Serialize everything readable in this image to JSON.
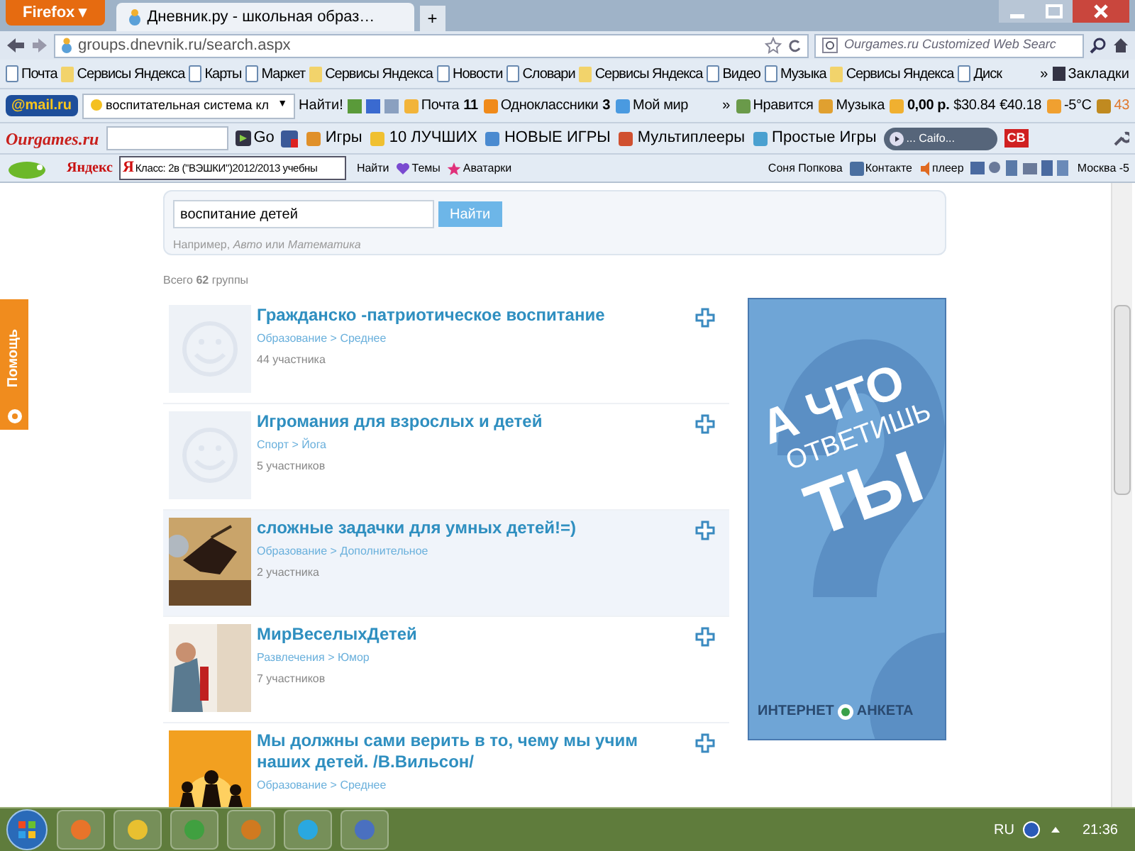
{
  "window": {
    "app_button": "Firefox",
    "menu_arrow": "▾",
    "new_tab": "+",
    "tab_title": "Дневник.ру - школьная образ…",
    "url": "groups.dnevnik.ru/search.aspx",
    "search_placeholder": "Ourgames.ru Customized Web Searc"
  },
  "bookmarks": [
    {
      "label": "Почта",
      "kind": "page"
    },
    {
      "label": "Сервисы Яндекса",
      "kind": "folder"
    },
    {
      "label": "Карты",
      "kind": "page"
    },
    {
      "label": "Маркет",
      "kind": "page"
    },
    {
      "label": "Сервисы Яндекса",
      "kind": "folder"
    },
    {
      "label": "Новости",
      "kind": "page"
    },
    {
      "label": "Словари",
      "kind": "page"
    },
    {
      "label": "Сервисы Яндекса",
      "kind": "folder"
    },
    {
      "label": "Видео",
      "kind": "page"
    },
    {
      "label": "Музыка",
      "kind": "page"
    },
    {
      "label": "Сервисы Яндекса",
      "kind": "folder"
    },
    {
      "label": "Диск",
      "kind": "page"
    }
  ],
  "bookmarks_more": "»",
  "bookmarks_menu": "Закладки",
  "mail_toolbar": {
    "logo": "@mail.ru",
    "search_value": "воспитательная система кл",
    "dropdown": "▼",
    "search_button": "Найти!",
    "links": [
      {
        "label": "Почта",
        "count": "11"
      },
      {
        "label": "Одноклассники",
        "count": "3"
      },
      {
        "label": "Мой мир"
      }
    ],
    "more": "»",
    "widgets": [
      "Нравится",
      "Музыка",
      "0,00 р.",
      "$30.84",
      "€40.18",
      "-5°C",
      "43"
    ]
  },
  "games_toolbar": {
    "logo": "Ourgames.ru",
    "go": "Go",
    "links": [
      "Игры",
      "10 ЛУЧШИХ",
      "НОВЫЕ ИГРЫ",
      "Мультиплееры",
      "Простые Игры"
    ],
    "player": "... Caifo...",
    "badge": "CB"
  },
  "yandex_toolbar": {
    "logo": "Яндекс",
    "field_badge": "Я",
    "field_value": "Класс: 2в (\"ВЭШКИ\")2012/2013 учебны",
    "find": "Найти",
    "links": [
      "Темы",
      "Аватарки"
    ],
    "user": "Соня Попкова",
    "vk": "Контакте",
    "player": "плеер",
    "weather": "Москва -5"
  },
  "help_tab": "Помощь",
  "search": {
    "value": "воспитание детей",
    "button": "Найти",
    "hint": "Например, *Авто* или *Математика*"
  },
  "total": "Всего **62** группы",
  "groups": [
    {
      "title": "Гражданско -патриотическое воспитание",
      "category": "Образование > Среднее",
      "members": "44 участника",
      "kind": "placeholder",
      "selected": false
    },
    {
      "title": "Игромания для взрослых и детей",
      "category": "Спорт > Йога",
      "members": "5 участников",
      "kind": "placeholder",
      "selected": false
    },
    {
      "title": "сложные задачки для умных детей!=)",
      "category": "Образование > Дополнительное",
      "members": "2 участника",
      "kind": "picture",
      "selected": true
    },
    {
      "title": "МирВеселыхДетей",
      "category": "Развлечения > Юмор",
      "members": "7 участников",
      "kind": "picture",
      "selected": false
    },
    {
      "title": "Мы должны сами верить в то, чему мы учим наших детей. /В.Вильсон/",
      "category": "Образование > Среднее",
      "kind": "picture",
      "selected": false
    }
  ],
  "ad": {
    "lines": [
      "А ЧТО",
      "ОТВЕТИШЬ",
      "ТЫ"
    ],
    "brand_left": "ИНТЕРНЕТ",
    "brand_right": "АНКЕТА"
  },
  "taskbar": {
    "language": "RU",
    "clock": "21:36"
  }
}
